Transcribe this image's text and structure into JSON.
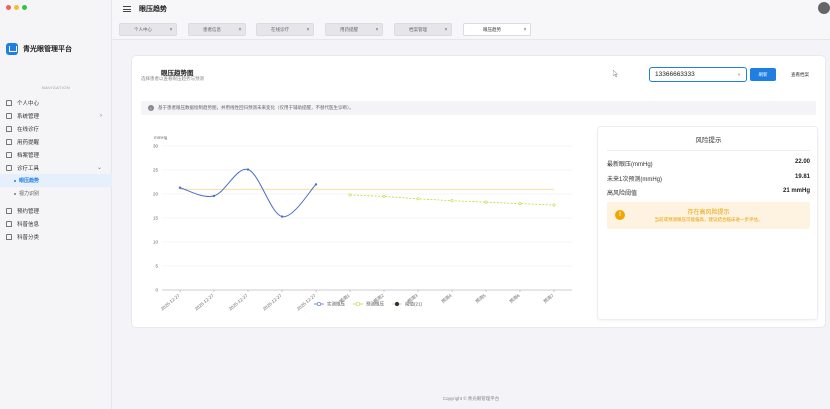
{
  "app": {
    "name": "青光眼管理平台",
    "nav_title": "NAVIGATION"
  },
  "topbar": {
    "page_title": "眼压趋势"
  },
  "sidebar": {
    "items": [
      {
        "label": "个人中心",
        "icon": "home-icon"
      },
      {
        "label": "系统管理",
        "icon": "folder-icon",
        "expandable": true,
        "expanded": false
      },
      {
        "label": "在线诊疗",
        "icon": "home-icon"
      },
      {
        "label": "用药提醒",
        "icon": "home-icon"
      },
      {
        "label": "档案管理",
        "icon": "home-icon"
      },
      {
        "label": "诊疗工具",
        "icon": "folder-icon",
        "expandable": true,
        "expanded": true
      }
    ],
    "subitems": [
      {
        "label": "眼压趋势",
        "active": true
      },
      {
        "label": "视力识别",
        "active": false
      }
    ],
    "items_after": [
      {
        "label": "预约管理",
        "icon": "home-icon"
      },
      {
        "label": "科普信息",
        "icon": "home-icon"
      },
      {
        "label": "科普分类",
        "icon": "home-icon"
      }
    ]
  },
  "tabs": [
    {
      "label": "个人中心",
      "active": false
    },
    {
      "label": "患者信息",
      "active": false
    },
    {
      "label": "在线诊疗",
      "active": false
    },
    {
      "label": "用药提醒",
      "active": false
    },
    {
      "label": "档案管理",
      "active": false
    },
    {
      "label": "眼压趋势",
      "active": true
    }
  ],
  "card": {
    "title": "眼压趋势图",
    "subtitle": "选择患者以查看眼压趋势与预测",
    "phone_value": "13366663333",
    "refresh_label": "刷新",
    "archive_label": "查看档案",
    "notice": "基于患者眼压数据绘制趋势图，并用线性回归预测未来变化（仅用于辅助提醒，不替代医生诊断）。"
  },
  "chart_data": {
    "type": "line",
    "ylabel": "mmHg",
    "ylim": [
      0,
      30
    ],
    "yticks": [
      0,
      5,
      10,
      15,
      20,
      25,
      30
    ],
    "categories": [
      "2025-12-27",
      "2025-12-27",
      "2025-12-27",
      "2025-12-27",
      "2025-12-27",
      "预测1",
      "预测2",
      "预测3",
      "预测4",
      "预测5",
      "预测6",
      "预测7"
    ],
    "threshold": 21,
    "series": [
      {
        "name": "实测眼压",
        "values": [
          21.3,
          19.6,
          25.1,
          15.3,
          22.0,
          null,
          null,
          null,
          null,
          null,
          null,
          null
        ],
        "color": "#4a6fc4"
      },
      {
        "name": "预测眼压",
        "values": [
          null,
          null,
          null,
          null,
          null,
          19.81,
          19.5,
          19.0,
          18.6,
          18.3,
          18.0,
          17.7
        ],
        "color": "#c8d43a"
      },
      {
        "name": "阈值(21)",
        "values": [],
        "color": "#f2c46f"
      }
    ],
    "legend": "bottom"
  },
  "risk": {
    "title": "风险提示",
    "rows": [
      {
        "label": "最新眼压(mmHg)",
        "value": "22.00"
      },
      {
        "label": "未来1次预测(mmHg)",
        "value": "19.81"
      },
      {
        "label": "高风险阈值",
        "value": "21 mmHg"
      }
    ],
    "alert_title": "存在高风险提示",
    "alert_text": "当前或预测眼压可能偏高，建议结合临床进一步评估。"
  },
  "footer": "Copyright © 青光眼管理平台"
}
